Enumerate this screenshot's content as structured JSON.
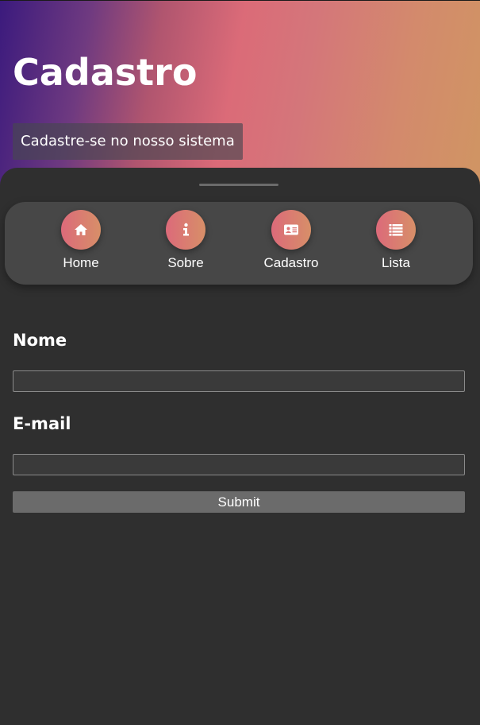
{
  "header": {
    "title": "Cadastro",
    "subtitle": "Cadastre-se no nosso sistema"
  },
  "nav": {
    "items": [
      {
        "label": "Home",
        "icon": "home-icon"
      },
      {
        "label": "Sobre",
        "icon": "info-icon"
      },
      {
        "label": "Cadastro",
        "icon": "id-card-icon"
      },
      {
        "label": "Lista",
        "icon": "list-icon"
      }
    ]
  },
  "form": {
    "name_label": "Nome",
    "name_value": "",
    "email_label": "E-mail",
    "email_value": "",
    "submit_label": "Submit"
  },
  "colors": {
    "background": "#2f2f2f",
    "nav_bar": "#474747",
    "accent_start": "#dc6a7a",
    "accent_end": "#d78f68",
    "hero_start": "#3b1a7d",
    "hero_mid": "#db6b78",
    "hero_end": "#d09563",
    "button": "#6b6b6b"
  }
}
